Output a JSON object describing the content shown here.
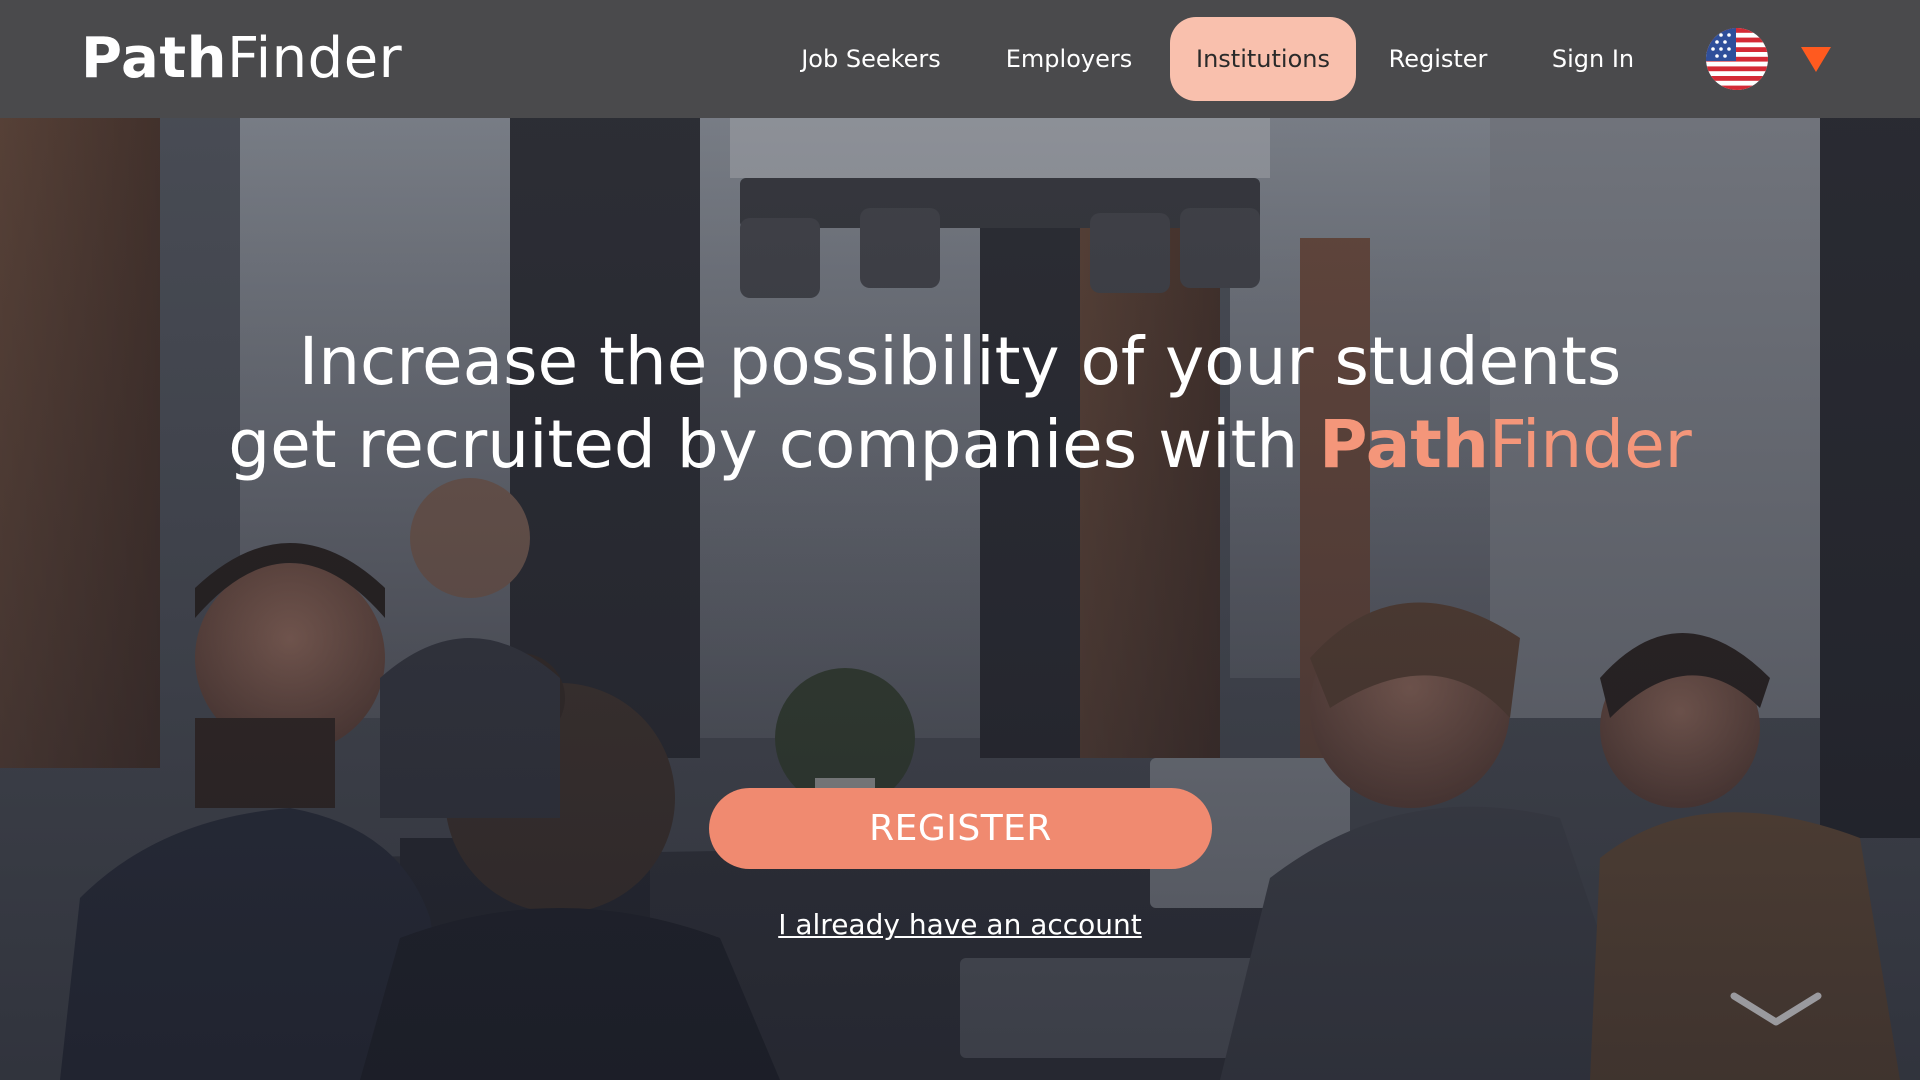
{
  "header": {
    "logo_bold": "Path",
    "logo_regular": "Finder",
    "nav": [
      {
        "label": "Job Seekers",
        "active": false
      },
      {
        "label": "Employers",
        "active": false
      },
      {
        "label": "Institutions",
        "active": true
      },
      {
        "label": "Register",
        "active": false
      },
      {
        "label": "Sign In",
        "active": false
      }
    ],
    "language_flag": "us-flag-icon",
    "language_caret": "caret-down-icon"
  },
  "hero": {
    "headline_line1": "Increase the possibility of your students",
    "headline_line2_prefix": "get recruited by companies with ",
    "headline_brand_bold": "Path",
    "headline_brand_regular": "Finder",
    "cta_label": "REGISTER",
    "secondary_link": "I already have an account",
    "scroll_icon": "chevron-down-icon"
  },
  "colors": {
    "header_bg": "#4a4a4c",
    "active_nav_bg": "#f9c0ad",
    "accent": "#f08a70",
    "brand_text": "#f4967a",
    "caret": "#ff5a1f"
  }
}
